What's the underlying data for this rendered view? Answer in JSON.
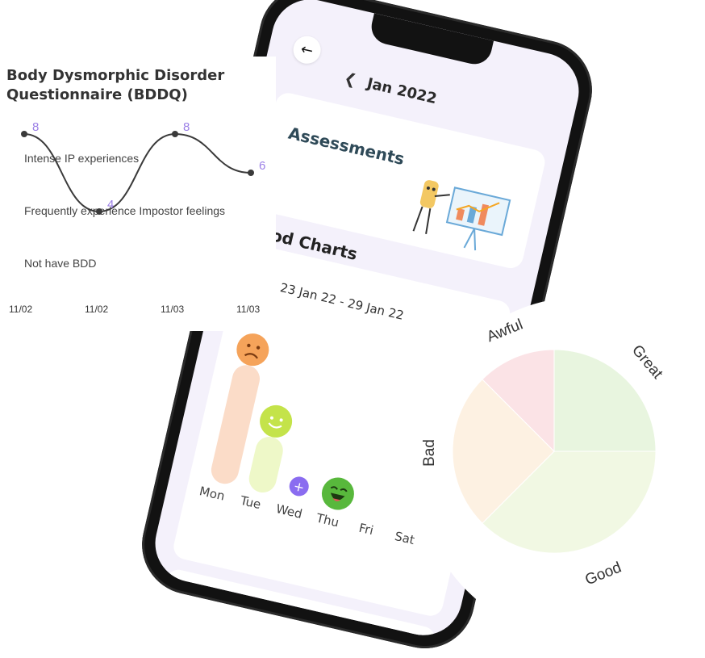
{
  "phone": {
    "month_label": "Jan 2022",
    "assessments_title": "Assessments",
    "mood_charts_title": "Mood Charts",
    "week_range": "23 Jan 22 - 29 Jan 22",
    "add_symbol": "+",
    "days": [
      "Mon",
      "Tue",
      "Wed",
      "Thu",
      "Fri",
      "Sat"
    ]
  },
  "bddq_chart": {
    "title": "Body Dysmorphic Disorder Questionnaire (BDDQ)",
    "y_categories": [
      "Intense IP experiences",
      "Frequently experience Impostor feelings",
      "Not have BDD"
    ],
    "x_labels": [
      "11/02",
      "11/02",
      "11/03",
      "11/03"
    ],
    "values": [
      8,
      4,
      8,
      6
    ],
    "line_color": "#3a3a3a",
    "label_color": "#9b7fe6"
  },
  "chart_data": [
    {
      "type": "line",
      "title": "Body Dysmorphic Disorder Questionnaire (BDDQ)",
      "x": [
        "11/02",
        "11/02",
        "11/03",
        "11/03"
      ],
      "series": [
        {
          "values": [
            8,
            4,
            8,
            6
          ]
        }
      ],
      "y_tick_labels": [
        "Intense IP experiences",
        "Frequently experience Impostor feelings",
        "Not have BDD"
      ],
      "grid": false
    },
    {
      "type": "pie",
      "categories": [
        "Great",
        "Good",
        "Bad",
        "Awful"
      ],
      "values": [
        25,
        37.5,
        25,
        12.5
      ],
      "colors": [
        "#e8f5df",
        "#f1f8e3",
        "#fdf1e2",
        "#fbe3e6"
      ]
    }
  ]
}
